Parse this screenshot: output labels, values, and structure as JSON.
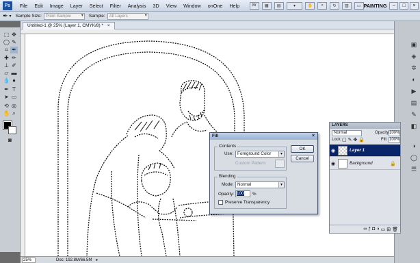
{
  "app": {
    "logo": "Ps"
  },
  "menu": [
    "File",
    "Edit",
    "Image",
    "Layer",
    "Select",
    "Filter",
    "Analysis",
    "3D",
    "View",
    "Window",
    "onOne",
    "Help"
  ],
  "menubar_icons": [
    "bridge-icon",
    "minibridge-icon",
    "view-extras-icon",
    "zoom-value-icon",
    "hand-icon",
    "zoom-icon",
    "rotate-icon",
    "arrange-icon",
    "screen-mode-icon"
  ],
  "workspace": "PAINTING",
  "window_buttons": [
    "–",
    "□",
    "×"
  ],
  "options": {
    "sample_size_label": "Sample Size:",
    "sample_size_value": "Point Sample",
    "sample_label": "Sample:",
    "sample_value": "All Layers"
  },
  "document": {
    "tab_title": "Untitled-1 @ 25% (Layer 1, CMYK/8) *",
    "close": "×"
  },
  "status": {
    "zoom": "25%",
    "doc_info": "Doc: 192.8M/66.5M"
  },
  "fill_dialog": {
    "title": "Fill",
    "close": "×",
    "contents_label": "Contents",
    "use_label": "Use:",
    "use_value": "Foreground Color",
    "custom_pattern_label": "Custom Pattern:",
    "blending_label": "Blending",
    "mode_label": "Mode:",
    "mode_value": "Normal",
    "opacity_label": "Opacity:",
    "opacity_value": "100",
    "opacity_unit": "%",
    "preserve_label": "Preserve Transparency",
    "preserve_checked": false,
    "ok": "OK",
    "cancel": "Cancel"
  },
  "layers_panel": {
    "title": "LAYERS",
    "blend_mode": "Normal",
    "opacity_label": "Opacity:",
    "opacity_value": "100%",
    "lock_label": "Lock:",
    "fill_label": "Fill:",
    "fill_value": "100%",
    "layers": [
      {
        "name": "Layer 1",
        "selected": true
      },
      {
        "name": "Background",
        "selected": false
      }
    ]
  },
  "colors": {
    "accent": "#0a246a",
    "dialog_bg": "#d8dce3",
    "selected_layer": "#0a246a"
  }
}
